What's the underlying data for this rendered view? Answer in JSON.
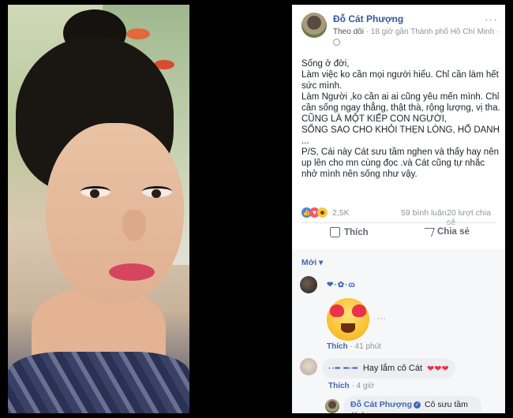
{
  "post": {
    "author": "Đỗ Cát Phượng",
    "follow_label": "Theo dõi",
    "time_location": "· 18 giờ gần Thành phố Hồ Chí Minh ·",
    "more_label": "···",
    "lines": [
      "Sống ở đời,",
      "Làm việc ko cần mọi người hiểu. Chỉ cần làm hết sức mình.",
      "Làm Người ,ko cần ai ai cũng yêu mến mình. Chỉ cần sống ngay thẳng, thật thà, rộng lượng, vị tha.",
      "CŨNG LÀ MỘT KIẾP CON NGƯỜI,",
      "SỐNG SAO CHO KHỎI THẸN LÒNG, HỔ DANH ...",
      "P/S, Cái này Cát sưu tầm nghen và thấy hay nên up lên cho mn cùng đọc .và Cát cũng tự nhắc nhở mình nên sống như vậy."
    ],
    "reactions_count": "2,5K",
    "comments_count": "59 bình luận",
    "shares_count": "20 lượt chia sẻ",
    "like_label": "Thích",
    "share_label": "Chia sẻ",
    "sort_label": "Mới ▾"
  },
  "comments": [
    {
      "name": "❤·✿·ɷ",
      "more": "···",
      "like": "Thích",
      "time": "· 41 phút"
    },
    {
      "name": "··━ ━·━",
      "text": "Hay lắm cô Cát",
      "hearts": "❤❤❤",
      "like": "Thích",
      "time": "· 4 giờ"
    }
  ],
  "reply": {
    "name": "Đỗ Cát Phượng",
    "badge": "✓",
    "text": "Cô sưu tầm áh kon."
  },
  "colors": {
    "link_blue": "#365899",
    "accent": "#4267b2",
    "heart": "#e8334a"
  }
}
